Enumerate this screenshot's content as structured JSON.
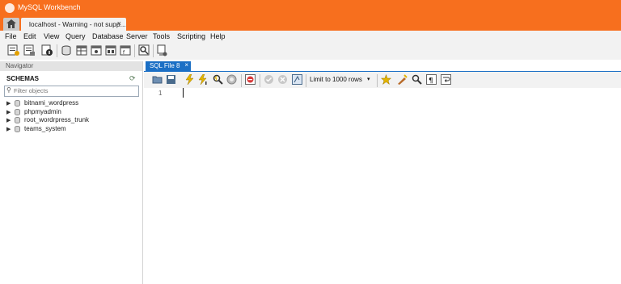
{
  "window": {
    "title": "MySQL Workbench"
  },
  "tabs": {
    "home_icon": "home-icon",
    "connection": {
      "label": "localhost - Warning - not supp...",
      "close": "×"
    }
  },
  "menu": [
    "File",
    "Edit",
    "View",
    "Query",
    "Database",
    "Server",
    "Tools",
    "Scripting",
    "Help"
  ],
  "navigator": {
    "header": "Navigator",
    "schemas_label": "SCHEMAS",
    "filter_placeholder": "Filter objects",
    "schemas": [
      "bitnami_wordpress",
      "phpmyadmin",
      "root_wordrpress_trunk",
      "teams_system"
    ]
  },
  "editor": {
    "tab": {
      "label": "SQL File 8",
      "close": "×"
    },
    "limit_label": "Limit to 1000 rows",
    "line_numbers": [
      "1"
    ]
  },
  "colors": {
    "accent": "#f76f1e",
    "tab_active": "#1b6fc5"
  }
}
